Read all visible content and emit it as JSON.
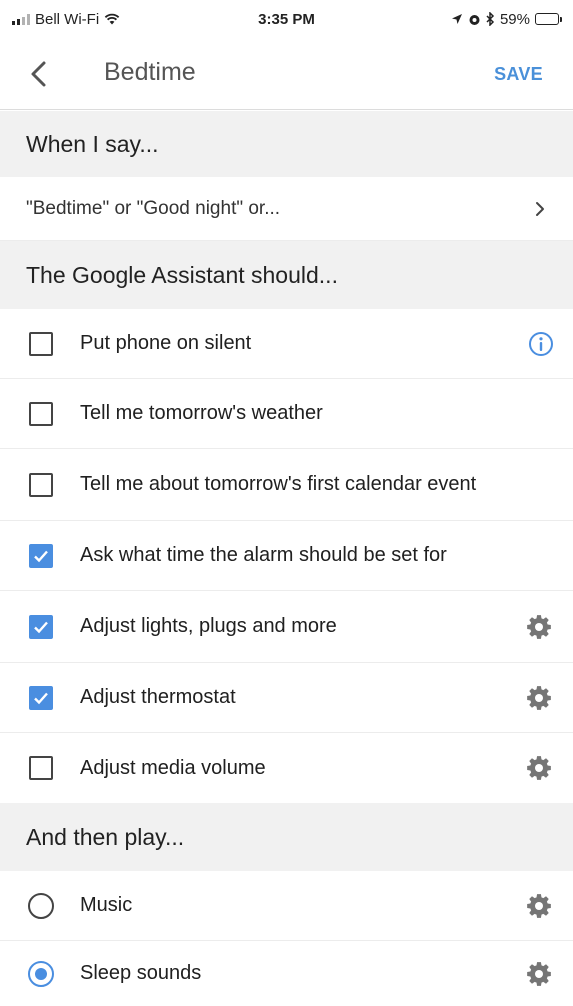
{
  "status_bar": {
    "carrier": "Bell Wi-Fi",
    "time": "3:35 PM",
    "battery": "59%",
    "battery_level": 0.59
  },
  "app_bar": {
    "title": "Bedtime",
    "save_label": "SAVE"
  },
  "trigger_section": {
    "header": "When I say...",
    "phrases": "\"Bedtime\" or \"Good night\" or..."
  },
  "actions_section": {
    "header": "The Google Assistant should...",
    "items": [
      {
        "label": "Put phone on silent",
        "checked": false,
        "icon": "info-icon"
      },
      {
        "label": "Tell me tomorrow's weather",
        "checked": false,
        "icon": ""
      },
      {
        "label": "Tell me about tomorrow's first calendar event",
        "checked": false,
        "icon": ""
      },
      {
        "label": "Ask what time the alarm should be set for",
        "checked": true,
        "icon": ""
      },
      {
        "label": "Adjust lights, plugs and more",
        "checked": true,
        "icon": "gear-icon"
      },
      {
        "label": "Adjust thermostat",
        "checked": true,
        "icon": "gear-icon"
      },
      {
        "label": "Adjust media volume",
        "checked": false,
        "icon": "gear-icon"
      }
    ]
  },
  "play_section": {
    "header": "And then play...",
    "options": [
      {
        "label": "Music",
        "selected": false,
        "icon": "gear-icon"
      },
      {
        "label": "Sleep sounds",
        "selected": true,
        "icon": "gear-icon"
      }
    ]
  },
  "colors": {
    "accent": "#4a8ee0",
    "save": "#4a90d9",
    "section_bg": "#f1f1f1"
  }
}
